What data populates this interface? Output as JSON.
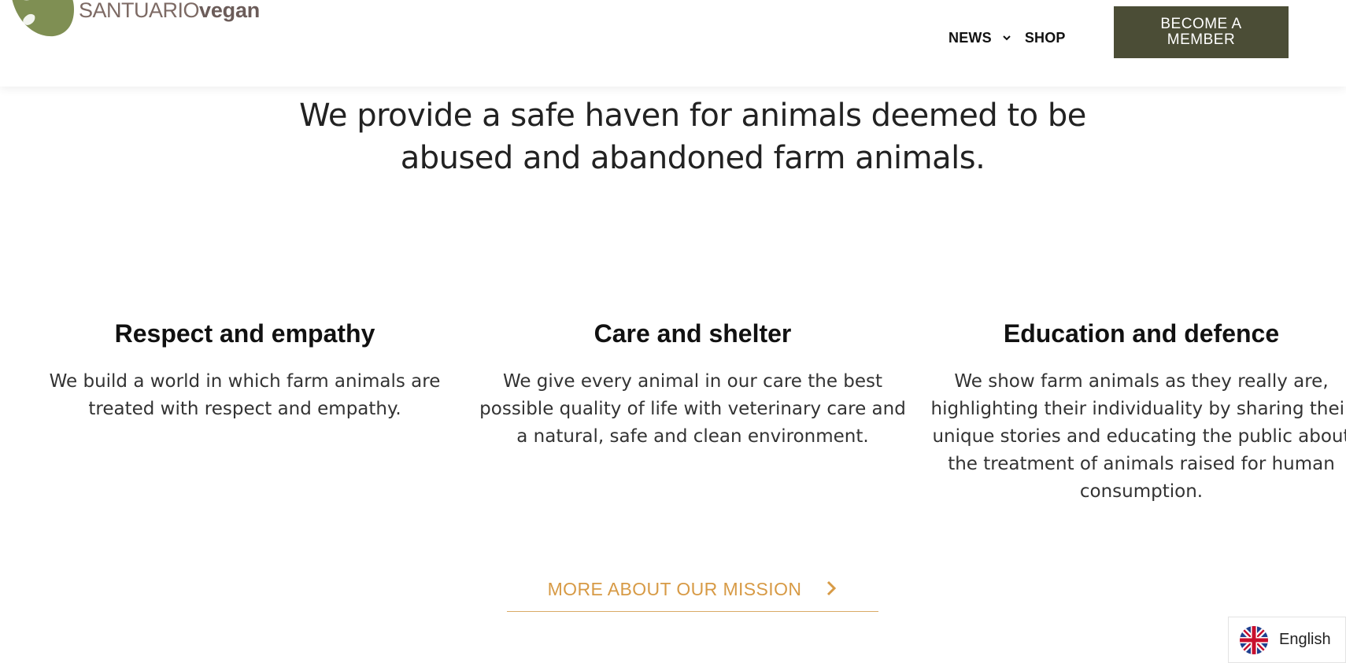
{
  "header": {
    "logo": {
      "text_first": "SANTUARIO",
      "text_second": "vegan",
      "icon": "leaf-logo-icon",
      "mark_color": "#7f8f53"
    },
    "nav": [
      {
        "label": "NEWS",
        "has_dropdown": true,
        "icon": "chevron-down-icon"
      },
      {
        "label": "SHOP",
        "has_dropdown": false
      }
    ],
    "cta_label": "BECOME A MEMBER",
    "cta_color": "#4b4d36"
  },
  "hero": {
    "line1": "We provide a safe haven for animals deemed to be",
    "line2": "abused and abandoned farm animals."
  },
  "columns": [
    {
      "title": "Respect and empathy",
      "text": "We build a world in which farm animals are treated with respect and empathy."
    },
    {
      "title": "Care and shelter",
      "text": "We give every animal in our care the best possible quality of life with veterinary care and a natural, safe and clean environment."
    },
    {
      "title": "Education and defence",
      "text": "We show farm animals as they really are, highlighting their individuality by sharing their unique stories and educating the public about the treatment of animals raised for human consumption."
    }
  ],
  "mission_link": {
    "label": "MORE ABOUT OUR MISSION",
    "icon": "chevron-right-icon",
    "color": "#d79a45"
  },
  "language": {
    "label": "English",
    "icon": "uk-flag-icon"
  }
}
